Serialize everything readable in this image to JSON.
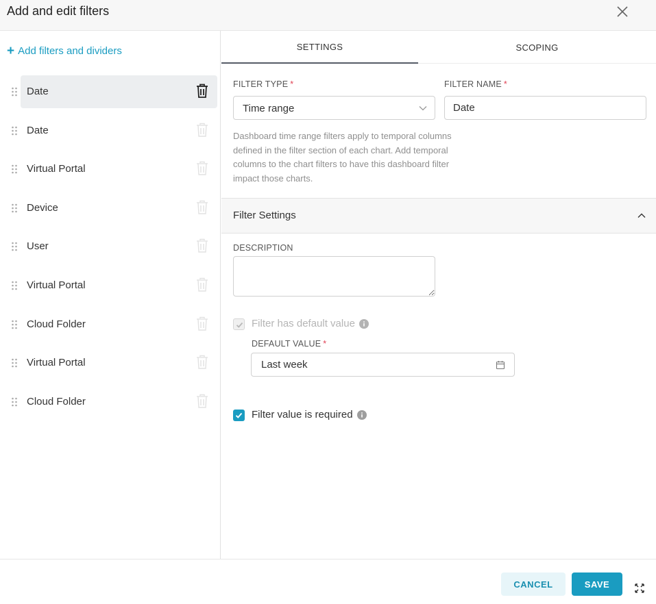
{
  "modal": {
    "title": "Add and edit filters",
    "close_icon": "close-icon"
  },
  "sidebar": {
    "add_label": "Add filters and dividers",
    "items": [
      {
        "label": "Date",
        "active": true
      },
      {
        "label": "Date",
        "active": false
      },
      {
        "label": "Virtual Portal",
        "active": false
      },
      {
        "label": "Device",
        "active": false
      },
      {
        "label": "User",
        "active": false
      },
      {
        "label": "Virtual Portal",
        "active": false
      },
      {
        "label": "Cloud Folder",
        "active": false
      },
      {
        "label": "Virtual Portal",
        "active": false
      },
      {
        "label": "Cloud Folder",
        "active": false
      }
    ]
  },
  "tabs": {
    "settings": "SETTINGS",
    "scoping": "SCOPING",
    "active": "settings"
  },
  "form": {
    "filter_type_label": "FILTER TYPE",
    "filter_type_value": "Time range",
    "filter_name_label": "FILTER NAME",
    "filter_name_value": "Date",
    "required_mark": "*",
    "help_text": "Dashboard time range filters apply to temporal columns defined in the filter section of each chart. Add temporal columns to the chart filters to have this dashboard filter impact those charts."
  },
  "filter_settings": {
    "title": "Filter Settings",
    "description_label": "DESCRIPTION",
    "default_value_checkbox_label": "Filter has default value",
    "default_value_checked": true,
    "default_value_disabled": true,
    "default_value_label": "DEFAULT VALUE",
    "default_value": "Last week",
    "required_checkbox_label": "Filter value is required",
    "required_checked": true
  },
  "footer": {
    "cancel_label": "CANCEL",
    "save_label": "SAVE"
  },
  "colors": {
    "accent": "#1a9cc1",
    "required": "#e04355",
    "active_item_bg": "#eceef0"
  }
}
